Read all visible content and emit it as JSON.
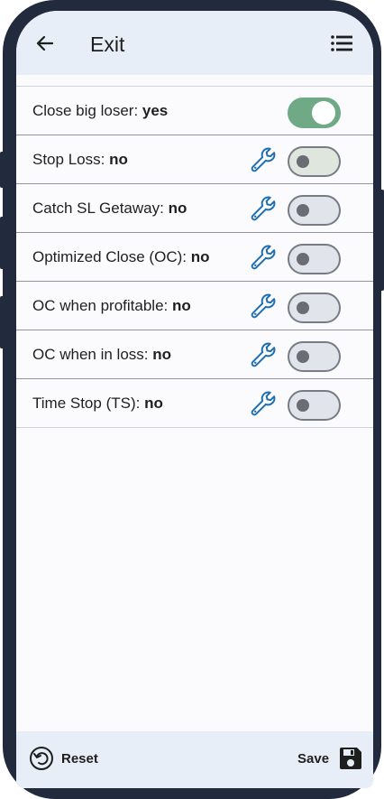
{
  "header": {
    "title": "Exit",
    "back_icon": "arrow-left-icon",
    "menu_icon": "list-icon"
  },
  "settings": [
    {
      "label": "Close big loser: ",
      "value": "yes",
      "on": true,
      "has_wrench": false
    },
    {
      "label": "Stop Loss: ",
      "value": "no",
      "on": false,
      "has_wrench": true
    },
    {
      "label": "Catch SL Getaway: ",
      "value": "no",
      "on": false,
      "has_wrench": true
    },
    {
      "label": "Optimized Close (OC): ",
      "value": "no",
      "on": false,
      "has_wrench": true
    },
    {
      "label": "OC when profitable: ",
      "value": "no",
      "on": false,
      "has_wrench": true
    },
    {
      "label": "OC when in loss: ",
      "value": "no",
      "on": false,
      "has_wrench": true
    },
    {
      "label": "Time Stop (TS): ",
      "value": "no",
      "on": false,
      "has_wrench": true
    }
  ],
  "footer": {
    "reset_label": "Reset",
    "save_label": "Save",
    "reset_icon": "undo-circle-icon",
    "save_icon": "floppy-disk-icon"
  },
  "colors": {
    "toggle_on": "#6fa986",
    "wrench": "#1f6fb0",
    "frame": "#222a3d",
    "header_bg": "#e8eef8"
  }
}
